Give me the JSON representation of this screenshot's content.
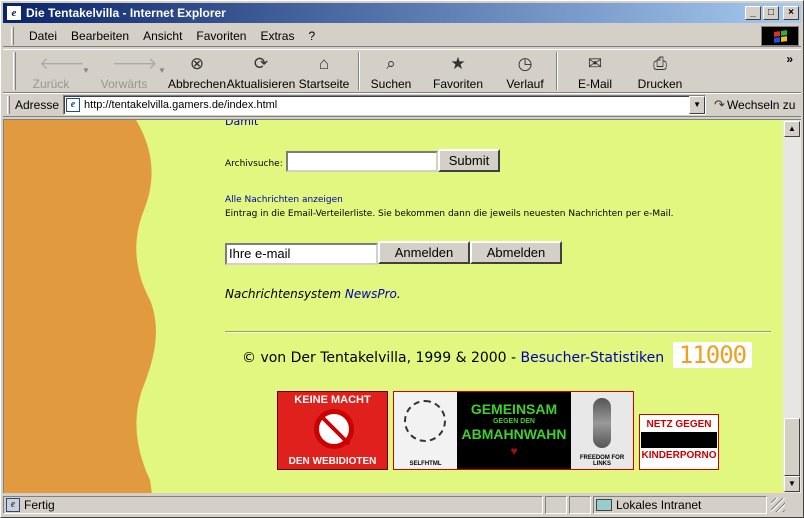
{
  "window": {
    "title": "Die Tentakelvilla - Internet Explorer",
    "controls": {
      "minimize": "_",
      "maximize": "□",
      "close": "×"
    }
  },
  "menu": [
    "Datei",
    "Bearbeiten",
    "Ansicht",
    "Favoriten",
    "Extras",
    "?"
  ],
  "toolbar": {
    "back": "Zurück",
    "forward": "Vorwärts",
    "stop": "Abbrechen",
    "refresh": "Aktualisieren",
    "home": "Startseite",
    "search": "Suchen",
    "favorites": "Favoriten",
    "history": "Verlauf",
    "mail": "E-Mail",
    "print": "Drucken",
    "more": "»"
  },
  "address": {
    "label": "Adresse",
    "url": "http://tentakelvilla.gamers.de/index.html",
    "go_label": "Wechseln zu"
  },
  "page": {
    "damit_link": "Damit",
    "archiv_label": "Archivsuche:",
    "archiv_value": "",
    "submit_label": "Submit",
    "all_news_link": "Alle Nachrichten anzeigen",
    "mail_note": "Eintrag in die Email-Verteilerliste. Sie bekommen dann die jeweils neuesten Nachrichten per e-Mail.",
    "email_value": "Ihre e-mail",
    "anmelden_label": "Anmelden",
    "abmelden_label": "Abmelden",
    "newssys_text": "Nachrichtensystem ",
    "newssys_link": "NewsPro",
    "newssys_end": ".",
    "copyright": "© von Der Tentakelvilla, 1999 & 2000 - ",
    "stats_link": "Besucher-Statistiken",
    "counter": "11000",
    "banners": {
      "keine_macht_top": "KEINE MACHT",
      "keine_macht_bottom": "DEN WEBIDIOTEN",
      "selfhtml": "SELFHTML",
      "gemeinsam": "GEMEINSAM",
      "gegen_den": "GEGEN DEN",
      "abmahnwahn": "ABMAHNWAHN",
      "freedom": "FREEDOM FOR LINKS",
      "netz_gegen": "NETZ GEGEN",
      "kinderporno": "KINDERPORNO"
    }
  },
  "status": {
    "text": "Fertig",
    "zone": "Lokales Intranet"
  },
  "colors": {
    "page_background": "#e1f77f",
    "wave_orange": "#e19a3f",
    "link_blue": "#0000b0",
    "counter_orange": "#f0a020",
    "titlebar_start": "#0a246a"
  }
}
